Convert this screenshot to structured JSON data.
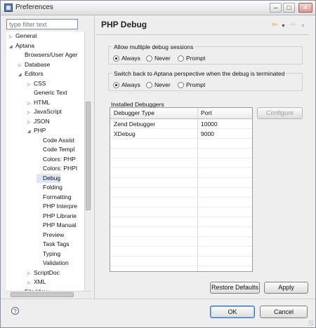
{
  "window": {
    "title": "Preferences"
  },
  "filter": {
    "placeholder": "type filter text"
  },
  "tree": [
    {
      "label": "General",
      "twisty": "collapsed"
    },
    {
      "label": "Aptana",
      "twisty": "expanded"
    },
    {
      "label": "Browsers/User Ager",
      "twisty": "none"
    },
    {
      "label": "Database",
      "twisty": "collapsed"
    },
    {
      "label": "Editors",
      "twisty": "expanded"
    },
    {
      "label": "CSS",
      "twisty": "collapsed"
    },
    {
      "label": "Generic Text",
      "twisty": "none"
    },
    {
      "label": "HTML",
      "twisty": "collapsed"
    },
    {
      "label": "JavaScript",
      "twisty": "collapsed"
    },
    {
      "label": "JSON",
      "twisty": "collapsed"
    },
    {
      "label": "PHP",
      "twisty": "expanded"
    },
    {
      "label": "Code Assist",
      "twisty": "none"
    },
    {
      "label": "Code Templ",
      "twisty": "none"
    },
    {
      "label": "Colors: PHP",
      "twisty": "none"
    },
    {
      "label": "Colors: PHPI",
      "twisty": "none"
    },
    {
      "label": "Debug",
      "twisty": "none",
      "selected": true
    },
    {
      "label": "Folding",
      "twisty": "none"
    },
    {
      "label": "Formatting",
      "twisty": "none"
    },
    {
      "label": "PHP Interpre",
      "twisty": "none"
    },
    {
      "label": "PHP Librarie",
      "twisty": "none"
    },
    {
      "label": "PHP Manual",
      "twisty": "none"
    },
    {
      "label": "Preview",
      "twisty": "none"
    },
    {
      "label": "Task Tags",
      "twisty": "none"
    },
    {
      "label": "Typing",
      "twisty": "none"
    },
    {
      "label": "Validation",
      "twisty": "none"
    },
    {
      "label": "ScriptDoc",
      "twisty": "collapsed"
    },
    {
      "label": "XML",
      "twisty": "collapsed"
    },
    {
      "label": "File View",
      "twisty": "none"
    }
  ],
  "page": {
    "title": "PHP Debug"
  },
  "multiple_sessions": {
    "label": "Allow multiple debug sessions",
    "options": [
      "Always",
      "Never",
      "Prompt"
    ],
    "selected": "Always"
  },
  "switch_perspective": {
    "label": "Switch back to Aptana perspective when the debug is terminated",
    "options": [
      "Always",
      "Never",
      "Prompt"
    ],
    "selected": "Always"
  },
  "debuggers": {
    "label": "Installed Debuggers",
    "columns": [
      "Debugger Type",
      "Port"
    ],
    "rows": [
      [
        "Zend Debugger",
        "10000"
      ],
      [
        "XDebug",
        "9000"
      ]
    ],
    "configure_label": "Configure"
  },
  "buttons": {
    "restore_defaults": "Restore Defaults",
    "apply": "Apply",
    "ok": "OK",
    "cancel": "Cancel",
    "help": "?"
  },
  "colors": {
    "selection": "#dde7f6",
    "accent": "#3f78b8"
  }
}
